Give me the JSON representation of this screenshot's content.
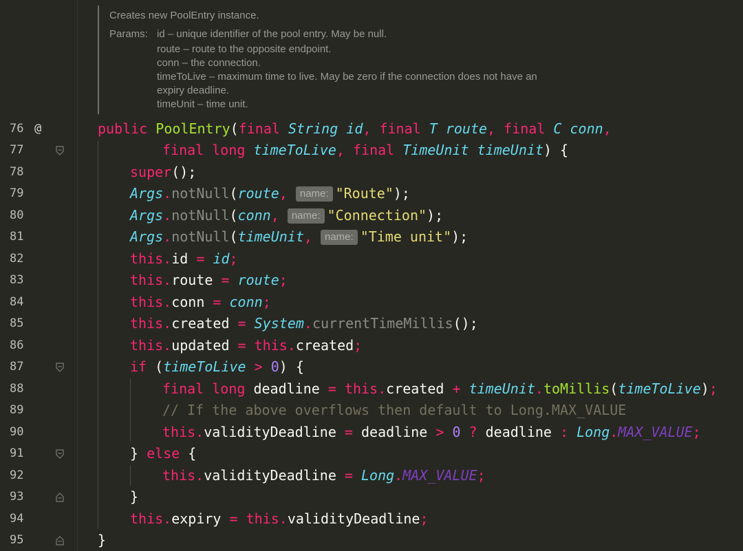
{
  "doc": {
    "summary": "Creates new PoolEntry instance.",
    "params_label": "Params:",
    "lines": [
      "id – unique identifier of the pool entry. May be null.",
      "route – route to the opposite endpoint.",
      "conn – the connection.",
      "timeToLive – maximum time to live. May be zero if the connection does not have an",
      "expiry deadline.",
      "timeUnit – time unit."
    ]
  },
  "gutter": {
    "line_numbers": [
      "76",
      "77",
      "78",
      "79",
      "80",
      "81",
      "82",
      "83",
      "84",
      "85",
      "86",
      "87",
      "88",
      "89",
      "90",
      "91",
      "92",
      "93",
      "94",
      "95"
    ],
    "override_marker": "@"
  },
  "code": {
    "l76": [
      "public",
      " ",
      "PoolEntry",
      "(",
      "final",
      " ",
      "String",
      " ",
      "id",
      ", ",
      "final",
      " ",
      "T",
      " ",
      "route",
      ", ",
      "final",
      " ",
      "C",
      " ",
      "conn",
      ","
    ],
    "l77": [
      "final",
      " ",
      "long",
      " ",
      "timeToLive",
      ", ",
      "final",
      " ",
      "TimeUnit",
      " ",
      "timeUnit",
      ") {"
    ],
    "l78": [
      "super",
      "();"
    ],
    "l79": [
      "Args",
      ".",
      "notNull",
      "(",
      "route",
      ", ",
      "name:",
      "\"Route\"",
      ");"
    ],
    "l80": [
      "Args",
      ".",
      "notNull",
      "(",
      "conn",
      ", ",
      "name:",
      "\"Connection\"",
      ");"
    ],
    "l81": [
      "Args",
      ".",
      "notNull",
      "(",
      "timeUnit",
      ", ",
      "name:",
      "\"Time unit\"",
      ");"
    ],
    "l82": [
      "this",
      ".",
      "id",
      " = ",
      "id",
      ";"
    ],
    "l83": [
      "this",
      ".",
      "route",
      " = ",
      "route",
      ";"
    ],
    "l84": [
      "this",
      ".",
      "conn",
      " = ",
      "conn",
      ";"
    ],
    "l85": [
      "this",
      ".",
      "created",
      " = ",
      "System",
      ".",
      "currentTimeMillis",
      "();"
    ],
    "l86": [
      "this",
      ".",
      "updated",
      " = ",
      "this",
      ".",
      "created",
      ";"
    ],
    "l87": [
      "if",
      " (",
      "timeToLive",
      " > ",
      "0",
      ") {"
    ],
    "l88": [
      "final",
      " ",
      "long",
      " deadline ",
      "=",
      " ",
      "this",
      ".",
      "created",
      " + ",
      "timeUnit",
      ".",
      "toMillis",
      "(",
      "timeToLive",
      ")",
      ";"
    ],
    "l89": [
      "// If the above overflows then default to Long.MAX_VALUE"
    ],
    "l90": [
      "this",
      ".",
      "validityDeadline",
      " = ",
      "deadline",
      " > ",
      "0",
      " ? ",
      "deadline",
      " : ",
      "Long",
      ".",
      "MAX_VALUE",
      ";"
    ],
    "l91": [
      "} ",
      "else",
      " {"
    ],
    "l92": [
      "this",
      ".",
      "validityDeadline",
      " = ",
      "Long",
      ".",
      "MAX_VALUE",
      ";"
    ],
    "l93": [
      "}"
    ],
    "l94": [
      "this",
      ".",
      "expiry",
      " = ",
      "this",
      ".",
      "validityDeadline",
      ";"
    ],
    "l95": [
      "}"
    ]
  }
}
